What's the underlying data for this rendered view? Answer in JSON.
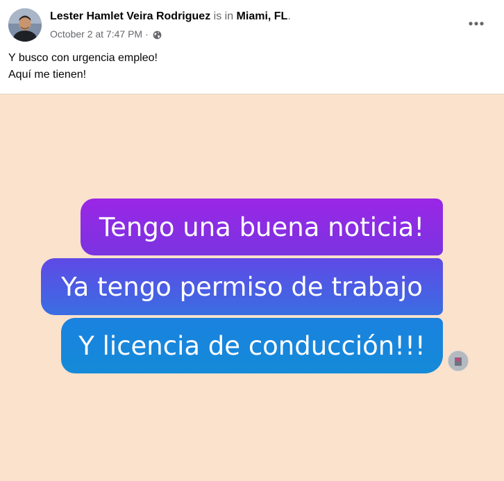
{
  "post": {
    "author": "Lester Hamlet Veira Rodriguez",
    "is_in": "is in",
    "location": "Miami, FL",
    "location_end": ".",
    "timestamp": "October 2 at 7:47 PM",
    "separator": "·",
    "privacy_icon": "globe-icon",
    "more_icon": "more-horizontal-icon",
    "text_lines": [
      "Y busco con urgencia empleo!",
      "Aquí me tienen!"
    ]
  },
  "image": {
    "background": "#fbe2cc",
    "bubbles": [
      "Tengo una buena noticia!",
      "Ya tengo permiso de trabajo",
      "Y licencia de conducción!!!"
    ]
  }
}
